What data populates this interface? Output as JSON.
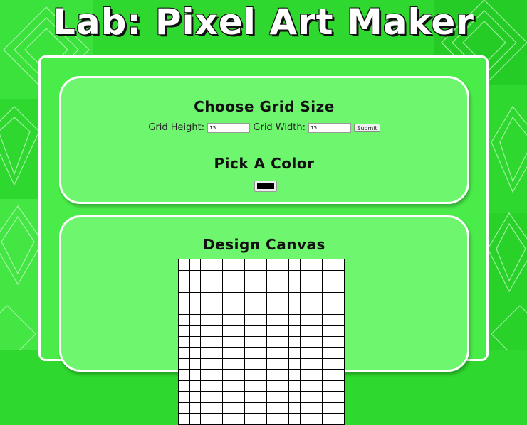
{
  "page": {
    "title": "Lab: Pixel Art Maker"
  },
  "size_section": {
    "heading": "Choose Grid Size",
    "height_label": "Grid Height:",
    "height_value": "15",
    "width_label": "Grid Width:",
    "width_value": "15",
    "submit_label": "Submit"
  },
  "color_section": {
    "heading": "Pick A Color",
    "selected_color": "#000000"
  },
  "canvas_section": {
    "heading": "Design Canvas",
    "rows": 15,
    "cols": 15
  },
  "colors": {
    "background": "#2fd82f",
    "panel": "#4aec4a",
    "card": "#6ef76e",
    "border": "#ffffff"
  }
}
